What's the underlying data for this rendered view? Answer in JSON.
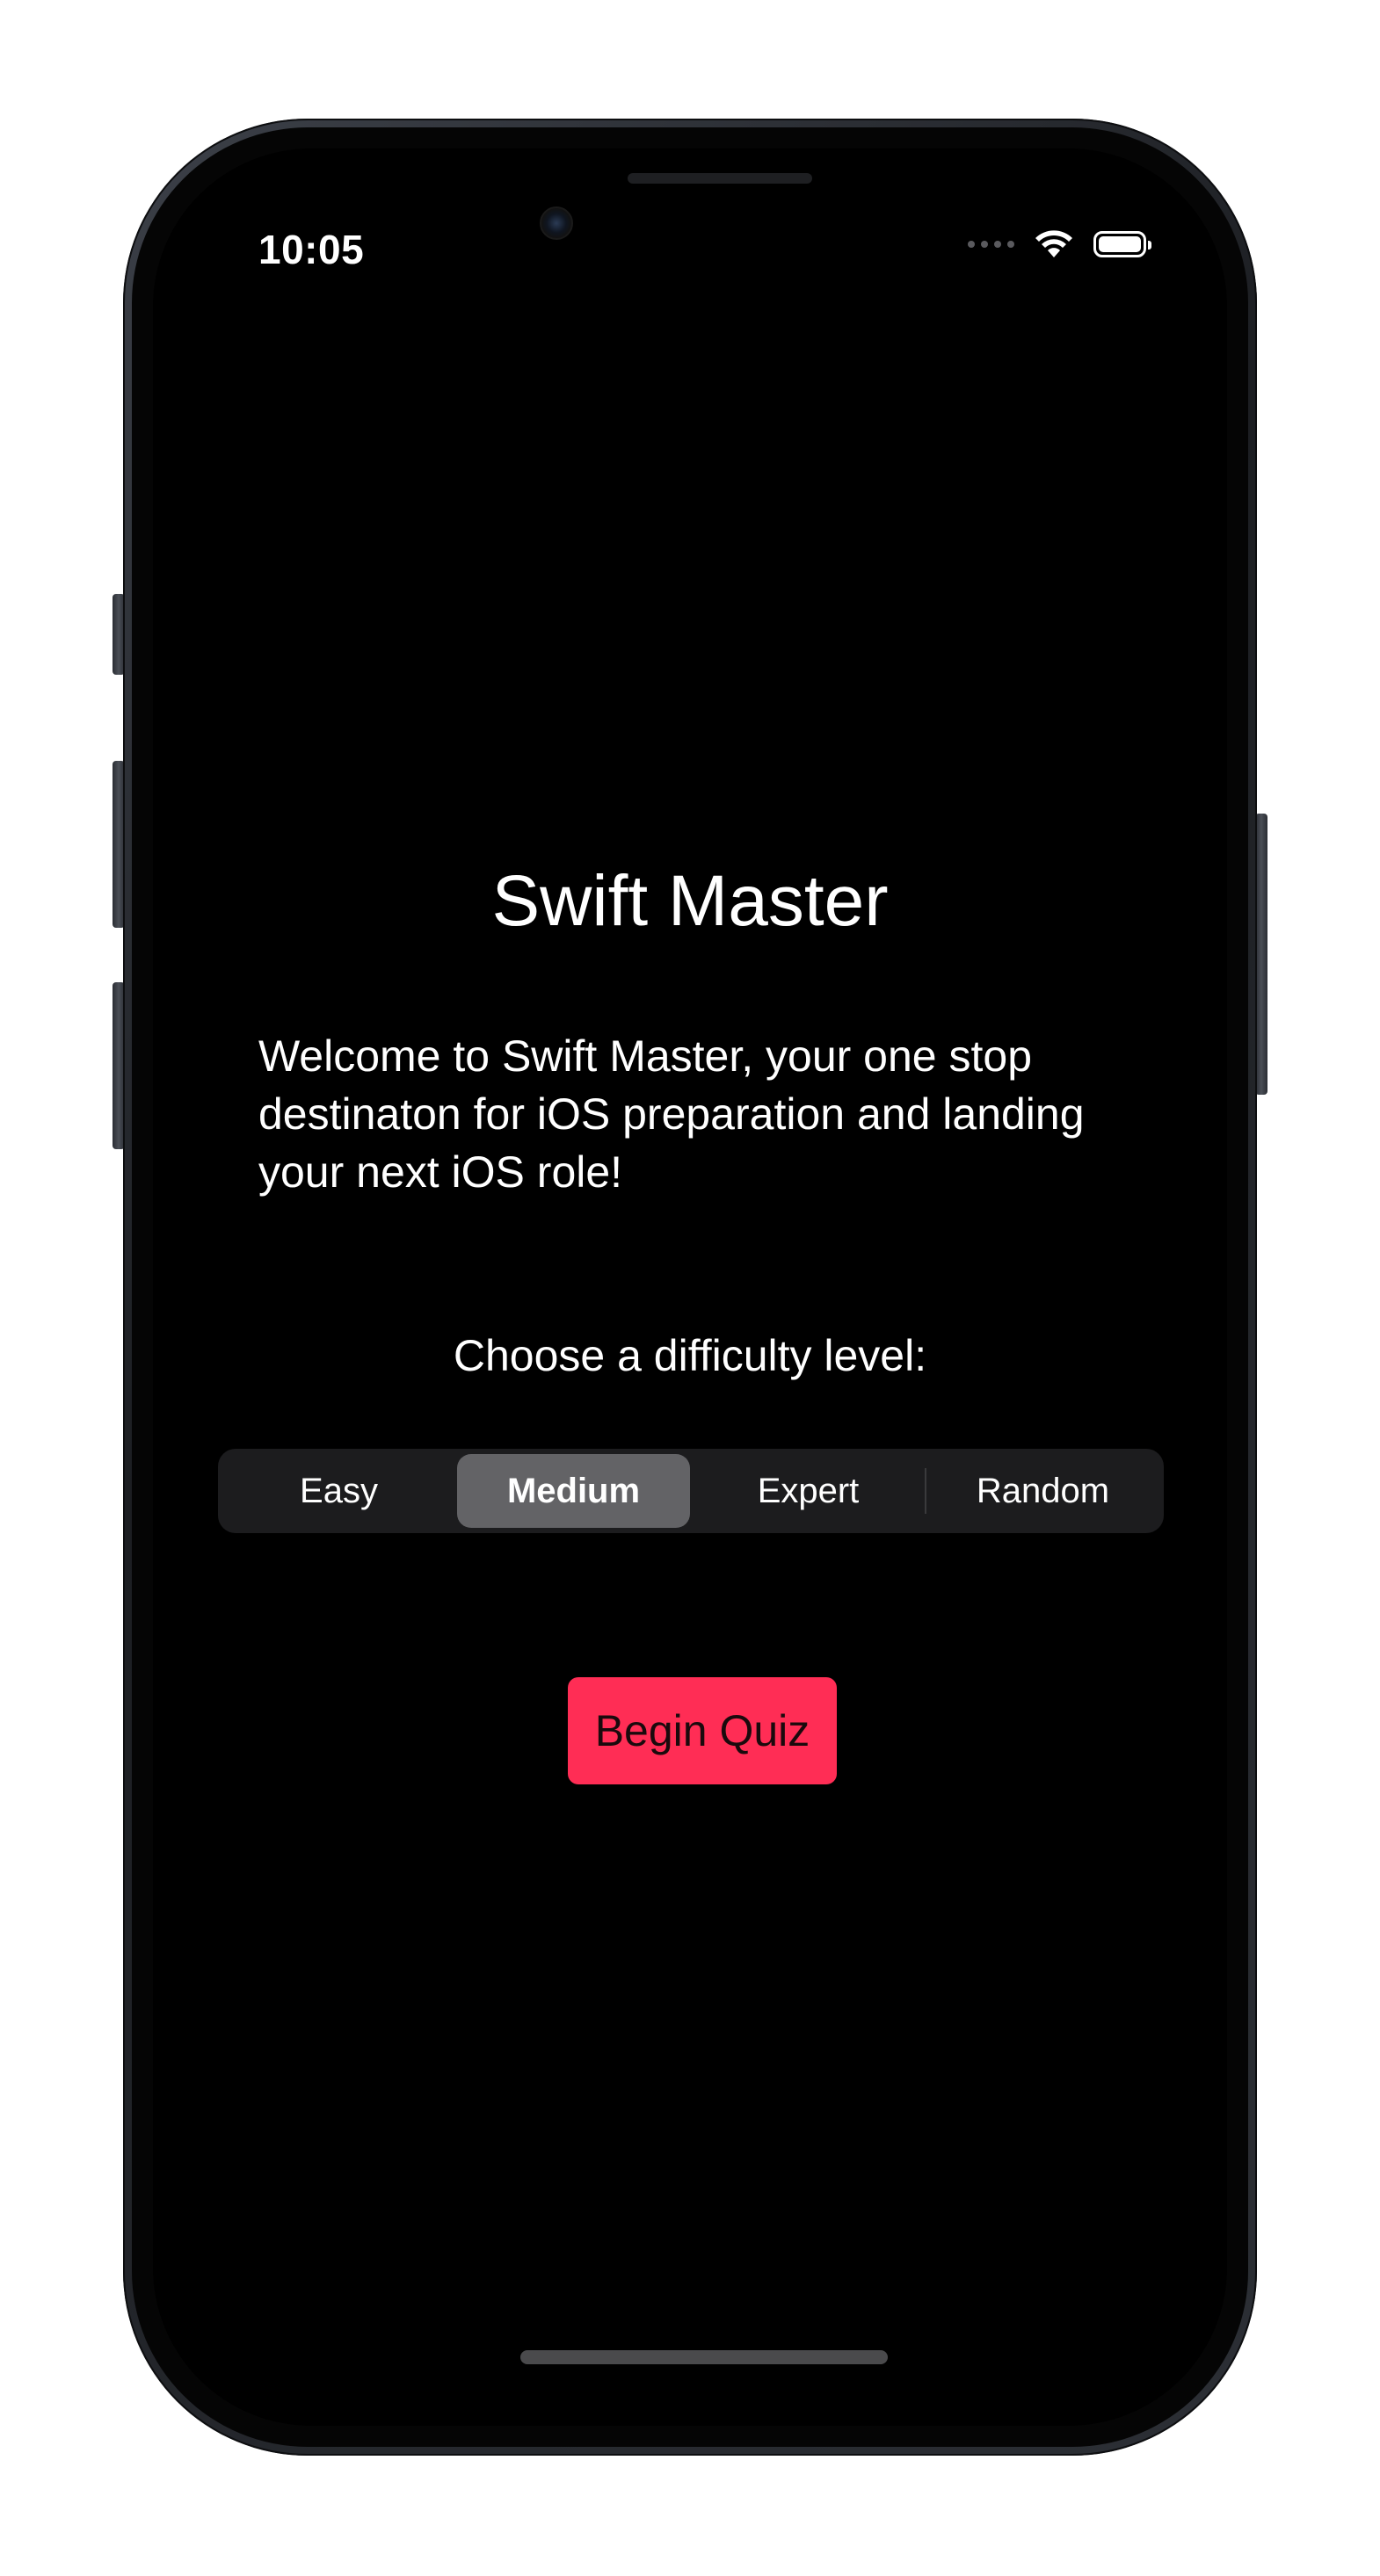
{
  "status_bar": {
    "time": "10:05",
    "icons": [
      "signal-dots-icon",
      "wifi-icon",
      "battery-icon"
    ]
  },
  "main": {
    "title": "Swift Master",
    "welcome_text": "Welcome to Swift Master, your one stop destinaton for iOS preparation and landing your next iOS role!",
    "difficulty_prompt": "Choose a difficulty level:",
    "difficulty_options": [
      "Easy",
      "Medium",
      "Expert",
      "Random"
    ],
    "selected_difficulty": "Medium",
    "begin_button_label": "Begin Quiz"
  },
  "colors": {
    "background": "#000000",
    "accent": "#ff2d55",
    "segment_background": "#1c1c1e",
    "segment_selected": "#636366",
    "text": "#ffffff"
  }
}
